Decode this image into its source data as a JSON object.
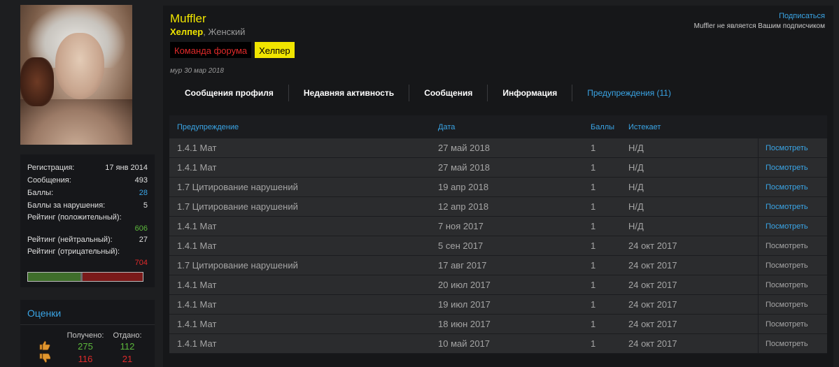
{
  "profile": {
    "username": "Muffler",
    "title_role": "Хелпер",
    "title_rest": ", Женский",
    "badges": [
      "Команда форума",
      "Хелпер"
    ],
    "meta": "мур 30 мар 2018",
    "subscribe_label": "Подписаться",
    "subscribe_note": "Muffler не является Вашим подписчиком"
  },
  "stats": {
    "reg_label": "Регистрация:",
    "reg_value": "17 янв 2014",
    "posts_label": "Сообщения:",
    "posts_value": "493",
    "points_label": "Баллы:",
    "points_value": "28",
    "violation_label": "Баллы за нарушения:",
    "violation_value": "5",
    "pos_label": "Рейтинг (положительный):",
    "pos_value": "606",
    "neu_label": "Рейтинг (нейтральный):",
    "neu_value": "27",
    "neg_label": "Рейтинг (отрицательный):",
    "neg_value": "704",
    "rating_bar_fractions": {
      "positive": 0.455,
      "neutral": 0.02,
      "negative": 0.525
    }
  },
  "ratings": {
    "title": "Оценки",
    "received_label": "Получено:",
    "given_label": "Отдано:",
    "likes_received": "275",
    "likes_given": "112",
    "dislikes_received": "116",
    "dislikes_given": "21"
  },
  "tabs": [
    "Сообщения профиля",
    "Недавняя активность",
    "Сообщения",
    "Информация",
    "Предупреждения (11)"
  ],
  "table": {
    "headers": {
      "warning": "Предупреждение",
      "date": "Дата",
      "points": "Баллы",
      "expires": "Истекает"
    },
    "view_label": "Посмотреть",
    "rows": [
      {
        "warning": "1.4.1 Мат",
        "date": "27 май 2018",
        "points": "1",
        "expires": "Н/Д",
        "active": true
      },
      {
        "warning": "1.4.1 Мат",
        "date": "27 май 2018",
        "points": "1",
        "expires": "Н/Д",
        "active": true
      },
      {
        "warning": "1.7 Цитирование нарушений",
        "date": "19 апр 2018",
        "points": "1",
        "expires": "Н/Д",
        "active": true
      },
      {
        "warning": "1.7 Цитирование нарушений",
        "date": "12 апр 2018",
        "points": "1",
        "expires": "Н/Д",
        "active": true
      },
      {
        "warning": "1.4.1 Мат",
        "date": "7 ноя 2017",
        "points": "1",
        "expires": "Н/Д",
        "active": true
      },
      {
        "warning": "1.4.1 Мат",
        "date": "5 сен 2017",
        "points": "1",
        "expires": "24 окт 2017",
        "active": false
      },
      {
        "warning": "1.7 Цитирование нарушений",
        "date": "17 авг 2017",
        "points": "1",
        "expires": "24 окт 2017",
        "active": false
      },
      {
        "warning": "1.4.1 Мат",
        "date": "20 июл 2017",
        "points": "1",
        "expires": "24 окт 2017",
        "active": false
      },
      {
        "warning": "1.4.1 Мат",
        "date": "19 июл 2017",
        "points": "1",
        "expires": "24 окт 2017",
        "active": false
      },
      {
        "warning": "1.4.1 Мат",
        "date": "18 июн 2017",
        "points": "1",
        "expires": "24 окт 2017",
        "active": false
      },
      {
        "warning": "1.4.1 Мат",
        "date": "10 май 2017",
        "points": "1",
        "expires": "24 окт 2017",
        "active": false
      }
    ]
  }
}
